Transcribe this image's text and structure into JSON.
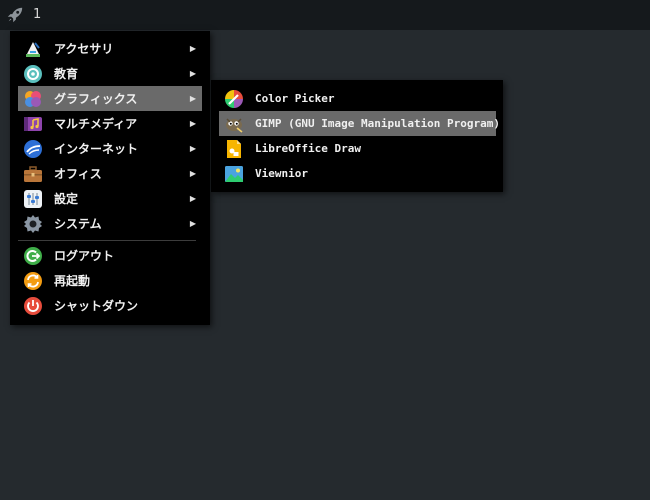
{
  "topbar": {
    "launcher_icon": "rocket-icon",
    "workspace_number": "1"
  },
  "main_menu": {
    "items": [
      {
        "label": "アクセサリ",
        "icon": "accessories-icon",
        "has_submenu": true
      },
      {
        "label": "教育",
        "icon": "education-icon",
        "has_submenu": true
      },
      {
        "label": "グラフィックス",
        "icon": "graphics-icon",
        "has_submenu": true,
        "highlighted": true
      },
      {
        "label": "マルチメディア",
        "icon": "multimedia-icon",
        "has_submenu": true
      },
      {
        "label": "インターネット",
        "icon": "internet-icon",
        "has_submenu": true
      },
      {
        "label": "オフィス",
        "icon": "office-icon",
        "has_submenu": true
      },
      {
        "label": "設定",
        "icon": "settings-icon",
        "has_submenu": true
      },
      {
        "label": "システム",
        "icon": "system-icon",
        "has_submenu": true
      }
    ],
    "session_items": [
      {
        "label": "ログアウト",
        "icon": "logout-icon"
      },
      {
        "label": "再起動",
        "icon": "reboot-icon"
      },
      {
        "label": "シャットダウン",
        "icon": "shutdown-icon"
      }
    ],
    "arrow": "▶"
  },
  "graphics_submenu": {
    "items": [
      {
        "label": "Color Picker",
        "icon": "color-picker-icon"
      },
      {
        "label": "GIMP (GNU Image Manipulation Program)",
        "icon": "gimp-icon",
        "highlighted": true
      },
      {
        "label": "LibreOffice Draw",
        "icon": "libreoffice-draw-icon"
      },
      {
        "label": "Viewnior",
        "icon": "viewnior-icon"
      }
    ]
  },
  "colors": {
    "desktop": "#252a2e",
    "panel": "#15191c",
    "menu_bg": "#000000",
    "highlight": "#6a6a6a"
  }
}
